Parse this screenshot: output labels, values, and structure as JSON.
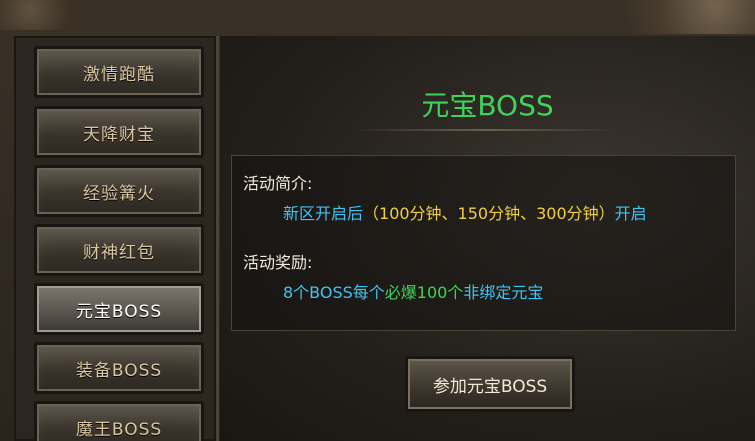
{
  "sidebar": {
    "items": [
      {
        "label": "激情跑酷"
      },
      {
        "label": "天降财宝"
      },
      {
        "label": "经验篝火"
      },
      {
        "label": "财神红包"
      },
      {
        "label": "元宝BOSS"
      },
      {
        "label": "装备BOSS"
      },
      {
        "label": "魔王BOSS"
      }
    ],
    "active_index": 4
  },
  "main": {
    "title": "元宝BOSS",
    "intro_label": "活动简介:",
    "intro": {
      "part1": "新区开启后",
      "part2": "（100分钟、150分钟、300分钟）",
      "part3": "开启"
    },
    "reward_label": "活动奖励:",
    "reward": {
      "part1": "8个BOSS每个",
      "part2": "必爆100个",
      "part3": "非绑定元宝"
    },
    "join_button": "参加元宝BOSS"
  },
  "colors": {
    "title": "#3fd35a",
    "text_blue": "#44c2f0",
    "text_yellow": "#f0d040",
    "text_green": "#3fd35a"
  }
}
